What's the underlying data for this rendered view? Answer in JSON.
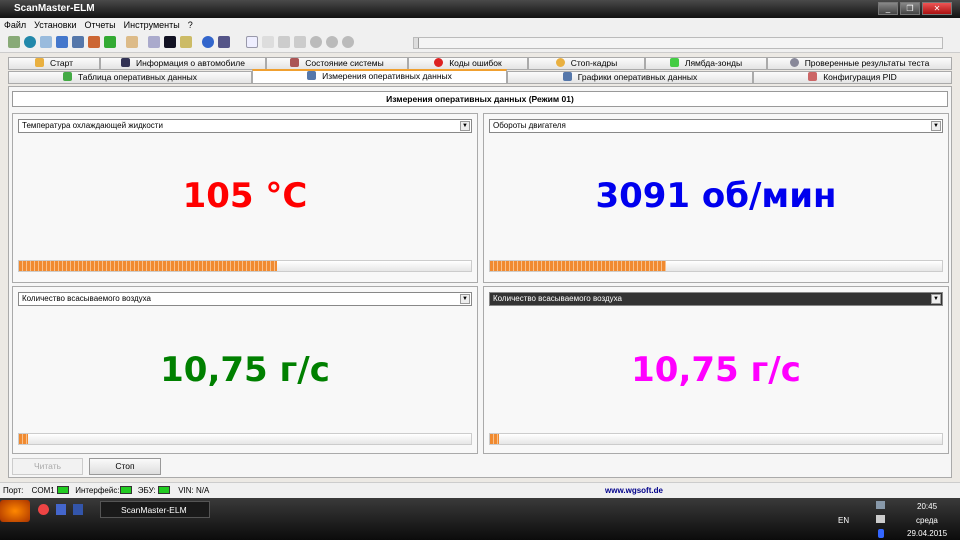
{
  "window": {
    "title": "ScanMaster-ELM",
    "minimize": "_",
    "restore": "❐",
    "close": "✕"
  },
  "menu": [
    "Файл",
    "Установки",
    "Отчеты",
    "Инструменты",
    "?"
  ],
  "tabs_row1": [
    "Старт",
    "Информация о автомобиле",
    "Состояние системы",
    "Коды ошибок",
    "Стоп-кадры",
    "Лямбда-зонды",
    "Проверенные результаты теста"
  ],
  "tabs_row2": [
    "Таблица оперативных данных",
    "Измерения оперативных данных",
    "Графики оперативных данных",
    "Конфигурация PID"
  ],
  "header": "Измерения оперативных данных (Режим 01)",
  "gauges": [
    {
      "pid": "Температура охлаждающей жидкости",
      "value": "105 °C",
      "color": "#ff0000",
      "progress": 0.57
    },
    {
      "pid": "Обороты двигателя",
      "value": "3091 об/мин",
      "color": "#0000ee",
      "progress": 0.39
    },
    {
      "pid": "Количество всасываемого воздуха",
      "value": "10,75 г/с",
      "color": "#008000",
      "progress": 0.02
    },
    {
      "pid": "Количество всасываемого воздуха",
      "value": "10,75 г/с",
      "color": "#ff00ff",
      "progress": 0.02
    }
  ],
  "buttons": {
    "read": "Читать",
    "stop": "Стоп"
  },
  "status": {
    "port_label": "Порт:",
    "port": "COM1",
    "interface": "Интерфейс:",
    "ecu": "ЭБУ:",
    "vin": "VIN: N/A",
    "url": "www.wgsoft.de"
  },
  "taskbar": {
    "app": "ScanMaster-ELM",
    "lang": "EN",
    "time": "20:45",
    "day": "среда",
    "date": "29.04.2015"
  }
}
